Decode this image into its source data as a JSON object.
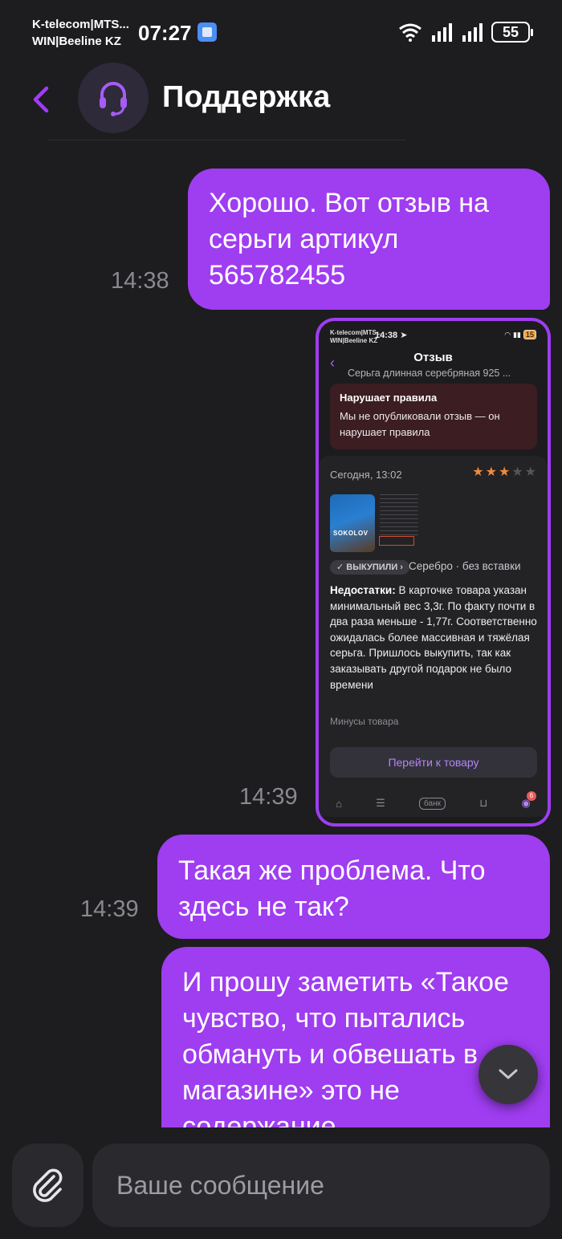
{
  "status_bar": {
    "carrier_line1": "K-telecom|MTS...",
    "carrier_line2": "WIN|Beeline KZ",
    "time": "07:27",
    "battery": "55"
  },
  "header": {
    "title": "Поддержка"
  },
  "messages": [
    {
      "text": "Хорошо. Вот отзыв на серьги артикул 565782455",
      "time": "14:38"
    },
    {
      "type": "image",
      "time": "14:39"
    },
    {
      "text": "Такая же проблема. Что здесь не так?",
      "time": "14:39"
    },
    {
      "text": "И прошу заметить «Такое чувство, что пытались обмануть и обвешать в магазине» это не содержание"
    }
  ],
  "shot": {
    "status_carrier1": "K-telecom|MTS...",
    "status_carrier2": "WIN|Beeline KZ",
    "status_time": "14:38",
    "status_battery": "15",
    "title": "Отзыв",
    "subtitle": "Серьга длинная серебряная 925 ...",
    "alert_title": "Нарушает правила",
    "alert_text": "Мы не опубликовали отзыв — он нарушает правила",
    "date": "Сегодня, 13:02",
    "rating": 3,
    "rating_max": 5,
    "star_color": "#f08a3c",
    "photo_label": "SOKOLOV",
    "badge": "✓ ВЫКУПИЛИ ›",
    "variant": "Серебро · без вставки",
    "review_label": "Недостатки:",
    "review_text": " В карточке товара указан минимальный вес 3,3г. По факту почти в два раза меньше - 1,77г. Соответственно ожидалась более массивная и тяжёлая серьга. Пришлось выкупить, так как заказывать другой подарок не было времени",
    "cons_link": "Минусы товара",
    "goto_button": "Перейти к товару",
    "nav_bank": "банк",
    "nav_profile_badge": "6"
  },
  "input": {
    "placeholder": "Ваше сообщение"
  },
  "colors": {
    "accent": "#9f3df1",
    "background": "#1d1c1f"
  }
}
